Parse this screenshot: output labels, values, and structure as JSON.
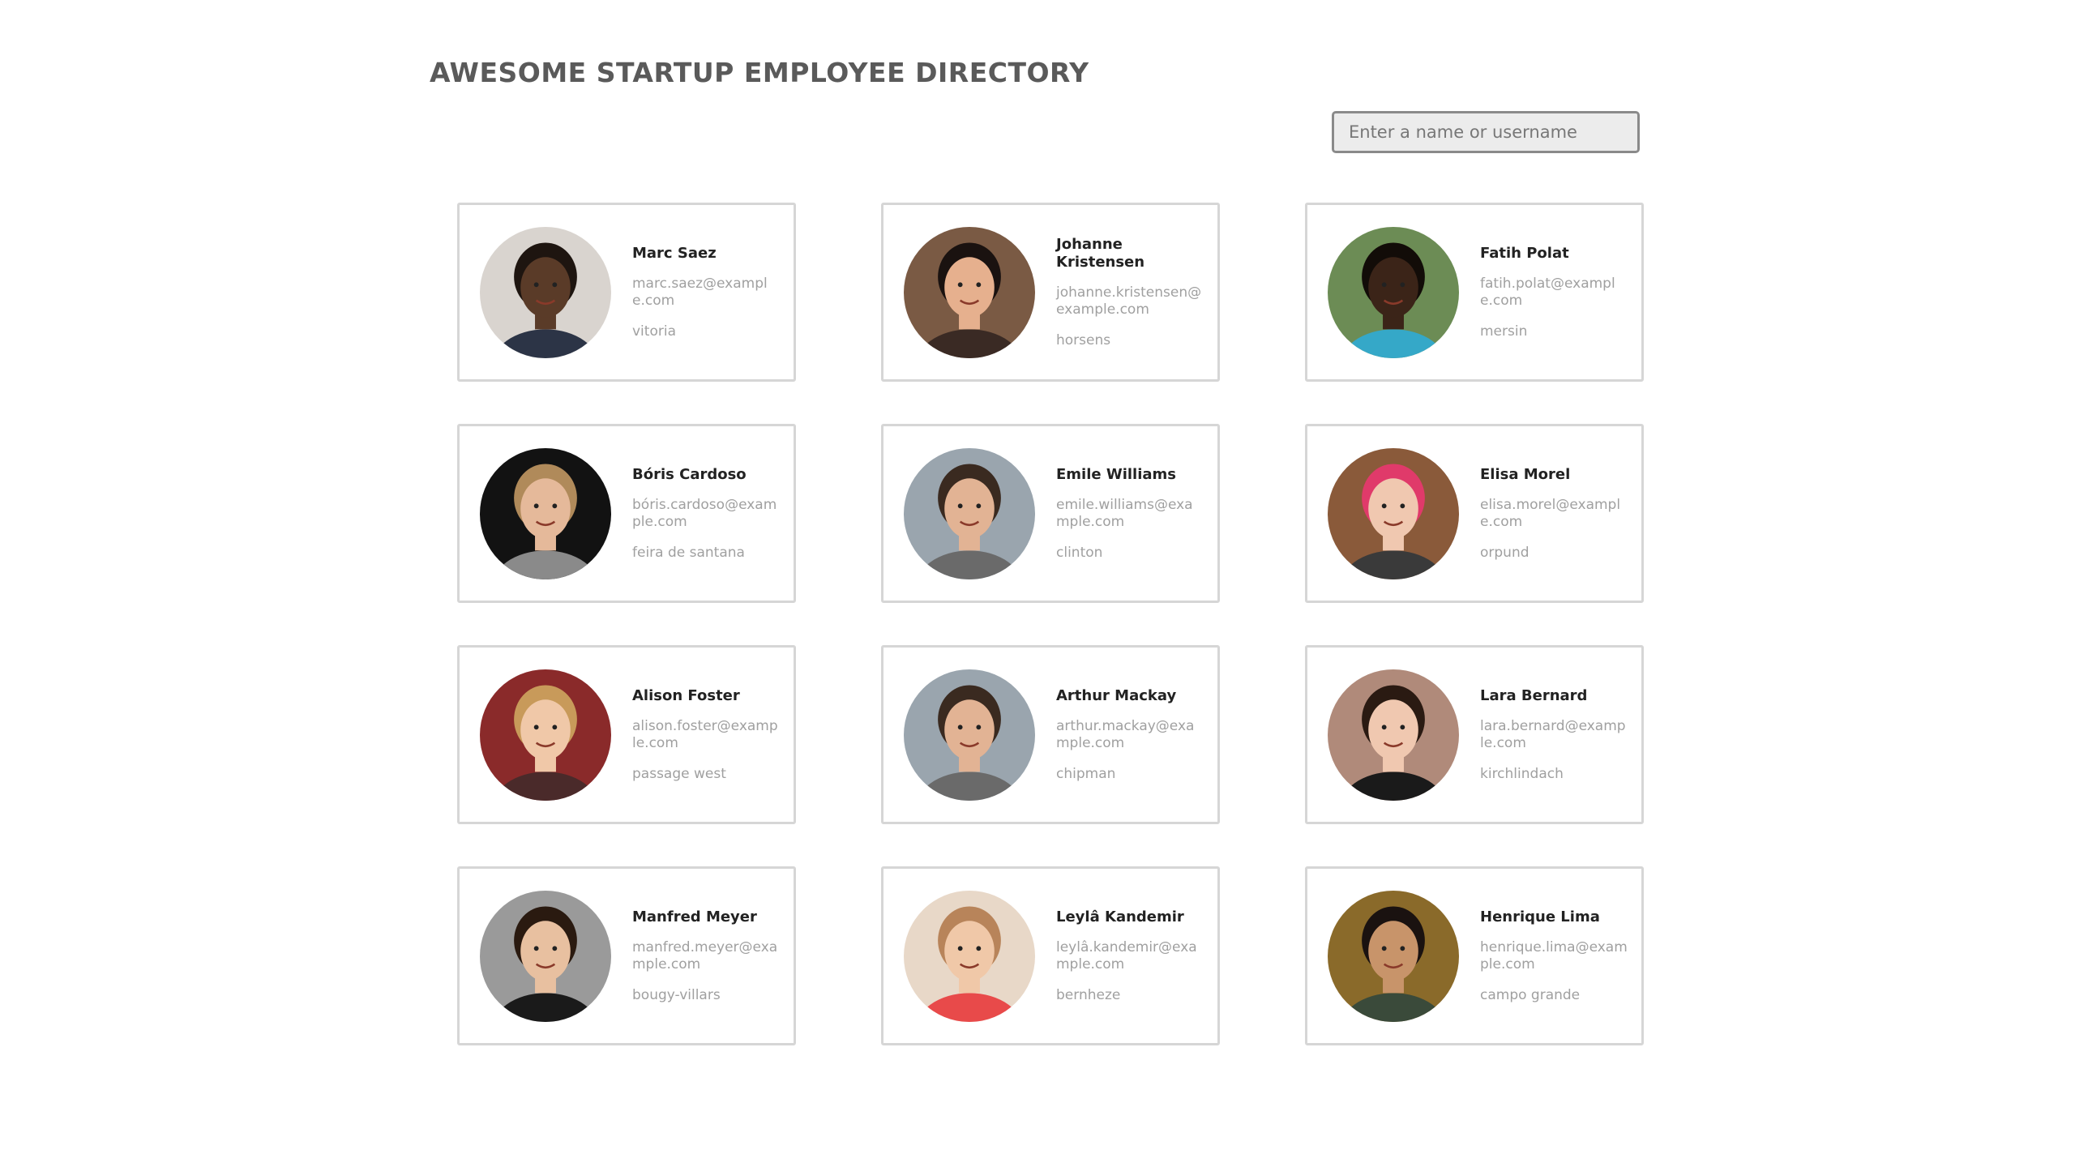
{
  "page": {
    "title": "AWESOME STARTUP EMPLOYEE DIRECTORY",
    "search_placeholder": "Enter a name or username"
  },
  "employees": [
    {
      "name": "Marc Saez",
      "email": "marc.saez@example.com",
      "city": "vitoria",
      "avatar_bg": "#d9d4cf",
      "skin": "#5a3b28",
      "hair": "#1e1510",
      "shirt": "#2c3446"
    },
    {
      "name": "Johanne Kristensen",
      "email": "johanne.kristensen@example.com",
      "city": "horsens",
      "avatar_bg": "#7a5a44",
      "skin": "#e6b08e",
      "hair": "#1a1210",
      "shirt": "#3a2a24"
    },
    {
      "name": "Fatih Polat",
      "email": "fatih.polat@example.com",
      "city": "mersin",
      "avatar_bg": "#6c8c55",
      "skin": "#3b2418",
      "hair": "#120c08",
      "shirt": "#35a8c8"
    },
    {
      "name": "Bóris Cardoso",
      "email": "bóris.cardoso@example.com",
      "city": "feira de santana",
      "avatar_bg": "#121212",
      "skin": "#e5b99a",
      "hair": "#b08a5a",
      "shirt": "#8a8a8a"
    },
    {
      "name": "Emile Williams",
      "email": "emile.williams@example.com",
      "city": "clinton",
      "avatar_bg": "#9aa5ae",
      "skin": "#e2b394",
      "hair": "#3a2a20",
      "shirt": "#6a6a6a"
    },
    {
      "name": "Elisa Morel",
      "email": "elisa.morel@example.com",
      "city": "orpund",
      "avatar_bg": "#8a5a3a",
      "skin": "#f0c8b0",
      "hair": "#e03a6a",
      "shirt": "#3a3a3a"
    },
    {
      "name": "Alison Foster",
      "email": "alison.foster@example.com",
      "city": "passage west",
      "avatar_bg": "#8a2a2a",
      "skin": "#f0c8a8",
      "hair": "#c89a5a",
      "shirt": "#4a2a2a"
    },
    {
      "name": "Arthur Mackay",
      "email": "arthur.mackay@example.com",
      "city": "chipman",
      "avatar_bg": "#9aa5ae",
      "skin": "#e2b394",
      "hair": "#3a2a20",
      "shirt": "#6a6a6a"
    },
    {
      "name": "Lara Bernard",
      "email": "lara.bernard@example.com",
      "city": "kirchlindach",
      "avatar_bg": "#b08a7a",
      "skin": "#f0c8b0",
      "hair": "#2a1a12",
      "shirt": "#1a1a1a"
    },
    {
      "name": "Manfred Meyer",
      "email": "manfred.meyer@example.com",
      "city": "bougy-villars",
      "avatar_bg": "#9a9a9a",
      "skin": "#e8c0a0",
      "hair": "#2a1a10",
      "shirt": "#1a1a1a"
    },
    {
      "name": "Leylâ Kandemir",
      "email": "leylâ.kandemir@example.com",
      "city": "bernheze",
      "avatar_bg": "#e8d8c8",
      "skin": "#f0c8a8",
      "hair": "#b8845a",
      "shirt": "#e84a4a"
    },
    {
      "name": "Henrique Lima",
      "email": "henrique.lima@example.com",
      "city": "campo grande",
      "avatar_bg": "#8a6a2a",
      "skin": "#c8946a",
      "hair": "#1a1210",
      "shirt": "#3a4a3a"
    }
  ]
}
